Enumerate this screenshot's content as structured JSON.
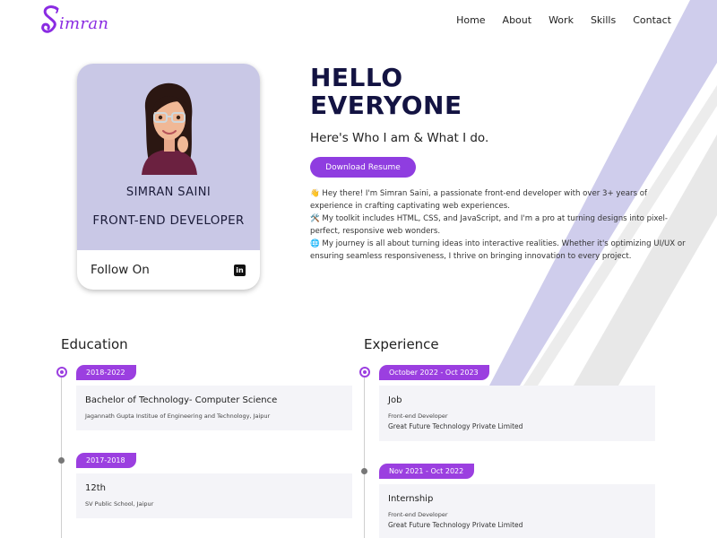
{
  "brand": {
    "logo_text": "imran",
    "logo_initial": "S"
  },
  "nav": {
    "items": [
      "Home",
      "About",
      "Work",
      "Skills",
      "Contact"
    ]
  },
  "profile": {
    "name": "SIMRAN SAINI",
    "role": "FRONT-END DEVELOPER",
    "follow_label": "Follow On",
    "linkedin_glyph": "in"
  },
  "hero": {
    "heading_line1": "HELLO",
    "heading_line2": "EVERYONE",
    "tagline": "Here's Who I am & What I do.",
    "resume_button": "Download Resume",
    "bio": [
      "👋 Hey there! I'm Simran Saini, a passionate front-end developer with over 3+ years of experience in crafting captivating web experiences.",
      "🛠️ My toolkit includes HTML, CSS, and JavaScript, and I'm a pro at turning designs into pixel-perfect, responsive web wonders.",
      "🌐 My journey is all about turning ideas into interactive realities. Whether it's optimizing UI/UX or ensuring seamless responsiveness, I thrive on bringing innovation to every project."
    ]
  },
  "education": {
    "title": "Education",
    "items": [
      {
        "period": "2018-2022",
        "title": "Bachelor of Technology- Computer Science",
        "subtitle": "Jagannath Gupta Institue of Engineering and Technology, Jaipur"
      },
      {
        "period": "2017-2018",
        "title": "12th",
        "subtitle": "SV Public School, Jaipur"
      }
    ]
  },
  "experience": {
    "title": "Experience",
    "items": [
      {
        "period": "October 2022 - Oct 2023",
        "title": "Job",
        "role": "Front-end Developer",
        "company": "Great Future Technology Private Limited"
      },
      {
        "period": "Nov 2021 - Oct 2022",
        "title": "Internship",
        "role": "Front-end Developer",
        "company": "Great Future Technology Private Limited"
      }
    ]
  },
  "colors": {
    "accent": "#9b3fe0",
    "card_bg": "#c9c8e6",
    "heading": "#131342",
    "stripe_purple": "#cfcdec",
    "stripe_gray": "#ececec"
  }
}
